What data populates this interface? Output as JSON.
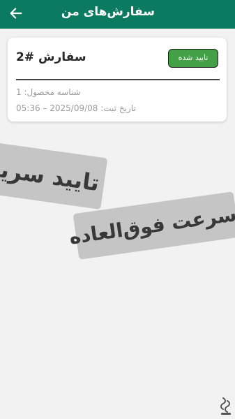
{
  "appbar": {
    "title": "سفارش‌های من",
    "back_icon": "arrow-left-icon",
    "color": "#0b7a61"
  },
  "orders": [
    {
      "title": "سفارش #2",
      "status": "تایید شده",
      "status_color": "#43a047",
      "product_id_line": "شناسه محصول: 1",
      "date_line": "تاریخ ثبت: 2025/09/08 – 05:36"
    }
  ],
  "promos": [
    {
      "text": "تایید سریع"
    },
    {
      "text": "سرعت فوق‌العاده"
    }
  ],
  "watermark": {
    "icon": "store-logo-icon"
  }
}
